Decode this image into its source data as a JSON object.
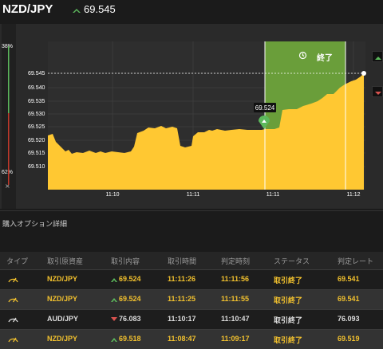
{
  "header": {
    "pair": "NZD/JPY",
    "price": "69.545",
    "direction_icon": "up-arrow-icon",
    "up_color": "#5cb85c"
  },
  "chart": {
    "pct_top": "38%",
    "pct_bottom": "62%",
    "close_symbol": "×",
    "current_price_label": "69.545",
    "entry_label": "69.524",
    "end_label": "終了",
    "y_ticks": [
      "69.545",
      "69.540",
      "69.535",
      "69.530",
      "69.525",
      "69.520",
      "69.515",
      "69.510"
    ],
    "x_ticks": [
      "11:10",
      "11:11",
      "11:11",
      "11:12"
    ],
    "fill_color": "#ffc832",
    "zone_color": "#6a9e3a"
  },
  "section": {
    "title": "購入オプション詳細"
  },
  "table": {
    "headers": [
      "タイプ",
      "取引原資産",
      "取引内容",
      "取引時間",
      "判定時刻",
      "ステータス",
      "判定レート"
    ],
    "rows": [
      {
        "pair": "NZD/JPY",
        "direction": "up",
        "content": "69.524",
        "time": "11:11:26",
        "judge": "11:11:56",
        "status": "取引終了",
        "rate": "69.541"
      },
      {
        "pair": "NZD/JPY",
        "direction": "up",
        "content": "69.524",
        "time": "11:11:25",
        "judge": "11:11:55",
        "status": "取引終了",
        "rate": "69.541"
      },
      {
        "pair": "AUD/JPY",
        "direction": "down",
        "content": "76.083",
        "time": "11:10:17",
        "judge": "11:10:47",
        "status": "取引終了",
        "rate": "76.093"
      },
      {
        "pair": "NZD/JPY",
        "direction": "up",
        "content": "69.518",
        "time": "11:08:47",
        "judge": "11:09:17",
        "status": "取引終了",
        "rate": "69.519"
      }
    ]
  }
}
